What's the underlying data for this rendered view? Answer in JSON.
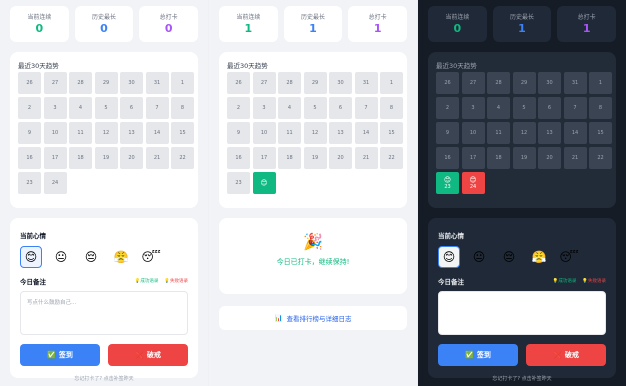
{
  "stats": {
    "streak_label": "当前连续",
    "longest_label": "历史最长",
    "total_label": "总打卡",
    "panel1": {
      "streak": "0",
      "longest": "0",
      "total": "0"
    },
    "panel2": {
      "streak": "1",
      "longest": "1",
      "total": "1"
    },
    "panel3": {
      "streak": "0",
      "longest": "1",
      "total": "1"
    }
  },
  "trend": {
    "title": "最近30天趋势",
    "days_row": [
      "26",
      "27",
      "28",
      "29",
      "30",
      "31",
      "1",
      "2",
      "3",
      "4",
      "5",
      "6",
      "7",
      "8",
      "9",
      "10",
      "11",
      "12",
      "13",
      "14",
      "15",
      "16",
      "17",
      "18",
      "19",
      "20",
      "21",
      "22",
      "23",
      "24"
    ]
  },
  "mood": {
    "title": "当前心情",
    "faces": [
      "😊",
      "😐",
      "😔",
      "😤",
      "😴"
    ]
  },
  "note": {
    "title": "今日备注",
    "success_tpl": "成功语录",
    "fail_tpl": "失败语录",
    "placeholder": "写点什么鼓励自己..."
  },
  "buttons": {
    "checkin": "签到",
    "break": "破戒"
  },
  "hint": "忘记打卡了? 点击补签昨天",
  "done": {
    "emoji": "🎉",
    "message": "今日已打卡，继续保持!"
  },
  "link": {
    "icon": "📊",
    "label": "查看排行榜与详细日志"
  },
  "icons": {
    "check": "✅",
    "cross": "❌",
    "bulb": "💡"
  },
  "colors": {
    "accent_blue": "#3b82f6",
    "success": "#10b981",
    "danger": "#ef4444",
    "purple": "#a855f7"
  }
}
